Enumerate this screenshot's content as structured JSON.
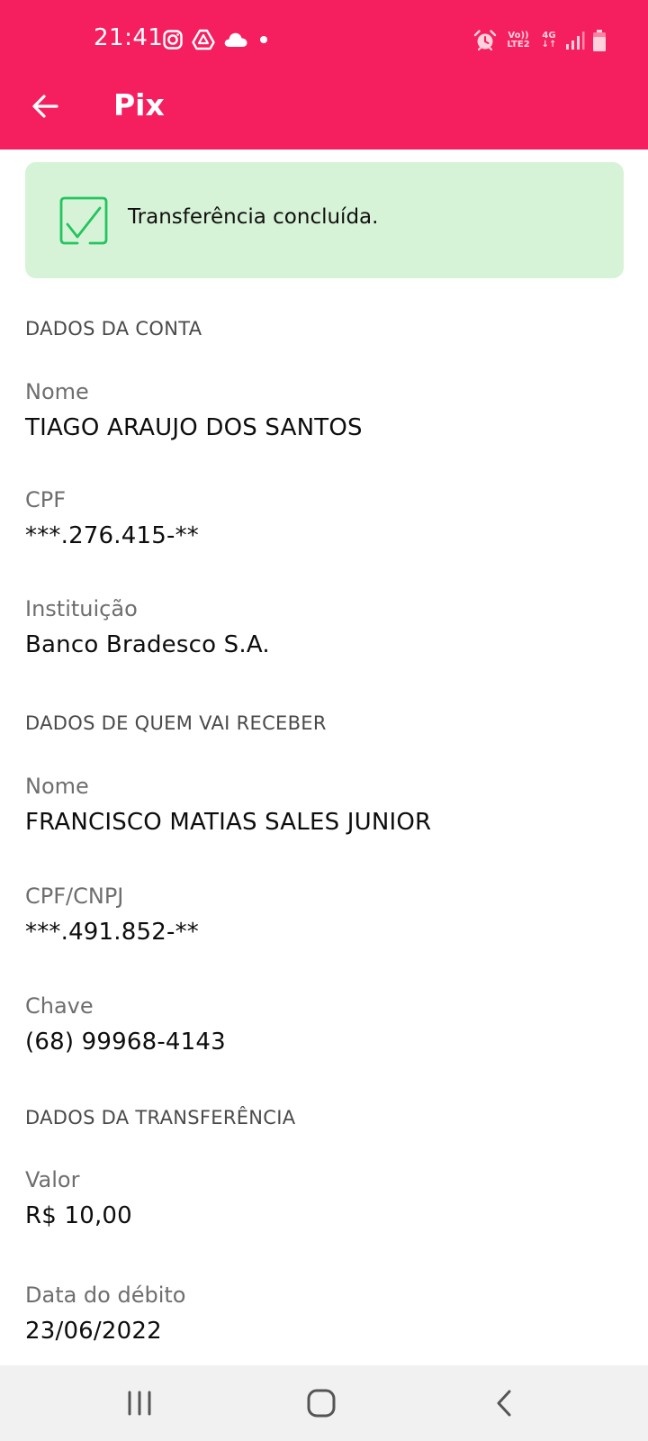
{
  "status_bar": {
    "time": "21:41",
    "network_top": "Vo))",
    "network_bottom": "LTE2",
    "network_type": "4G",
    "icons_left": [
      "instagram-icon",
      "drive-icon",
      "cloud-icon",
      "dot-icon"
    ],
    "icons_right": [
      "alarm-icon",
      "volte-icon",
      "4g-icon",
      "signal-icon",
      "battery-icon"
    ]
  },
  "app_bar": {
    "title": "Pix",
    "back_icon": "arrow-left-icon"
  },
  "banner": {
    "message": "Transferência concluída.",
    "icon": "check-square-icon"
  },
  "account": {
    "section_title": "DADOS DA CONTA",
    "name_label": "Nome",
    "name_value": "TIAGO ARAUJO DOS SANTOS",
    "cpf_label": "CPF",
    "cpf_value": "***.276.415-**",
    "institution_label": "Instituição",
    "institution_value": "Banco Bradesco S.A."
  },
  "receiver": {
    "section_title": "DADOS DE QUEM VAI RECEBER",
    "name_label": "Nome",
    "name_value": "FRANCISCO MATIAS SALES JUNIOR",
    "doc_label": "CPF/CNPJ",
    "doc_value": "***.491.852-**",
    "key_label": "Chave",
    "key_value": "(68) 99968-4143"
  },
  "transfer": {
    "section_title": "DADOS DA TRANSFERÊNCIA",
    "amount_label": "Valor",
    "amount_value": "R$ 10,00",
    "date_label": "Data do débito",
    "date_value": "23/06/2022"
  },
  "nav_bar": {
    "items": [
      "recent-apps-icon",
      "home-icon",
      "back-icon"
    ]
  },
  "colors": {
    "primary": "#f51f5f",
    "banner_bg": "#d7f3d7",
    "success_green": "#22c55e",
    "nav_bg": "#f1f1f1"
  }
}
